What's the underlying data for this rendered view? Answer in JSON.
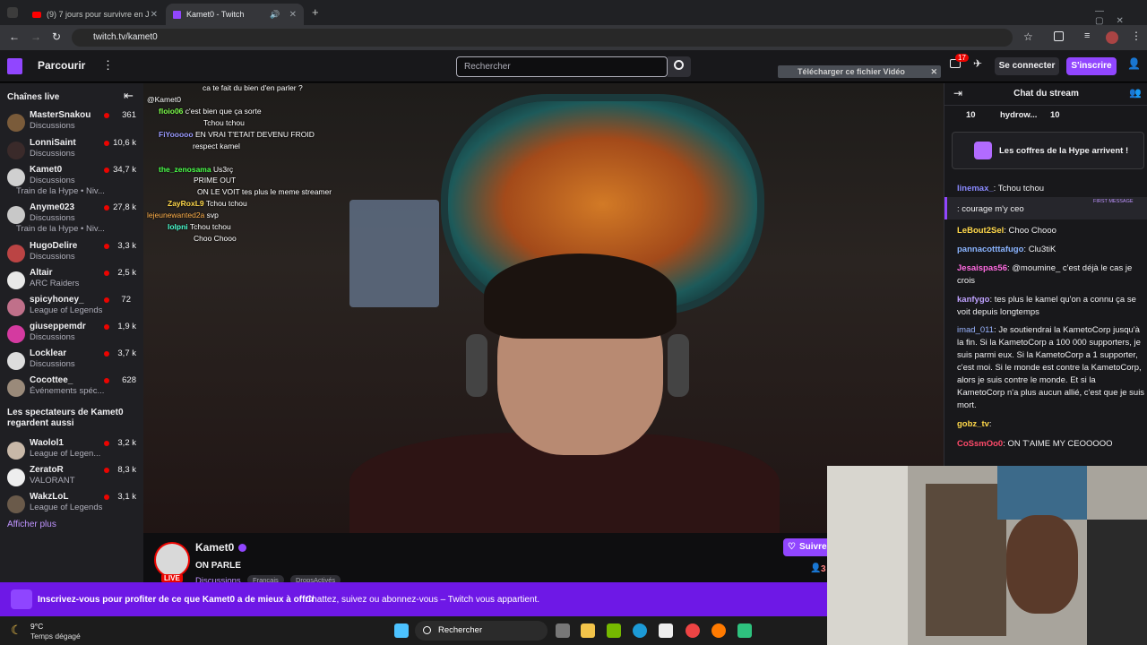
{
  "browser": {
    "tabs": [
      {
        "label": "(9) 7 jours pour survivre en Jung",
        "active": false
      },
      {
        "label": "Kamet0 - Twitch",
        "active": true
      }
    ],
    "url": "twitch.tv/kamet0"
  },
  "topnav": {
    "browse": "Parcourir",
    "search_placeholder": "Rechercher",
    "notif_count": "17",
    "login": "Se connecter",
    "signup": "S'inscrire"
  },
  "extension": {
    "download_label": "Télécharger ce fichier Vidéo"
  },
  "sidebar": {
    "live_heading": "Chaînes live",
    "channels": [
      {
        "name": "MasterSnakou",
        "category": "Discussions",
        "viewers": "361",
        "color": "#7a5b3a"
      },
      {
        "name": "LonniSaint",
        "category": "Discussions",
        "viewers": "10,6 k",
        "color": "#3a2a2a"
      },
      {
        "name": "Kamet0",
        "category": "Discussions",
        "viewers": "34,7 k",
        "extra": "Train de la Hype • Niv...",
        "color": "#d0d0d0"
      },
      {
        "name": "Anyme023",
        "category": "Discussions",
        "viewers": "27,8 k",
        "extra": "Train de la Hype • Niv...",
        "color": "#c8c8c8"
      },
      {
        "name": "HugoDelire",
        "category": "Discussions",
        "viewers": "3,3 k",
        "color": "#b44"
      },
      {
        "name": "Altair",
        "category": "ARC Raiders",
        "viewers": "2,5 k",
        "color": "#e8e8e8"
      },
      {
        "name": "spicyhoney_",
        "category": "League of Legends",
        "viewers": "72",
        "color": "#c0708a"
      },
      {
        "name": "giuseppemdr",
        "category": "Discussions",
        "viewers": "1,9 k",
        "color": "#d43aa0"
      },
      {
        "name": "Locklear",
        "category": "Discussions",
        "viewers": "3,7 k",
        "color": "#ddd"
      },
      {
        "name": "Cocottee_",
        "category": "Événements spéc...",
        "viewers": "628",
        "color": "#9a8a7a"
      }
    ],
    "also_heading_1": "Les spectateurs de Kamet0",
    "also_heading_2": "regardent aussi",
    "also": [
      {
        "name": "Waolol1",
        "category": "League of Legen...",
        "viewers": "3,2 k",
        "color": "#c8b8a8"
      },
      {
        "name": "ZeratoR",
        "category": "VALORANT",
        "viewers": "8,3 k",
        "color": "#eee"
      },
      {
        "name": "WakzLoL",
        "category": "League of Legends",
        "viewers": "3,1 k",
        "color": "#6a5a4a"
      }
    ],
    "show_more": "Afficher plus"
  },
  "overlay_chat": [
    {
      "user": "",
      "text": "ca te fait du bien d'en parler ?",
      "color": "#ff4a4a"
    },
    {
      "user": "",
      "text": "@Kamet0",
      "color": "#fff"
    },
    {
      "user": "floio06",
      "text": "c'est bien que ça sorte",
      "color": "#7cff4a"
    },
    {
      "user": "",
      "text": "Tchou tchou",
      "color": "#ff4a4a"
    },
    {
      "user": "FiYooooo",
      "text": "EN VRAI T'ETAIT DEVENU FROID",
      "color": "#9a9aff"
    },
    {
      "user": "",
      "text": "respect kamel",
      "color": "#4a4aff"
    },
    {
      "user": "",
      "text": "",
      "color": "#ff4a4a"
    },
    {
      "user": "the_zenosama",
      "text": "Us3rç",
      "color": "#4aff4a"
    },
    {
      "user": "",
      "text": "PRIME OUT",
      "color": "#ff4a4a"
    },
    {
      "user": "",
      "text": "ON LE VOIT tes plus le meme streamer",
      "color": "#4a4aff"
    },
    {
      "user": "ZayRoxL9",
      "text": "Tchou tchou",
      "color": "#ffd84a"
    },
    {
      "user": "lejeunewanted2a",
      "text": "svp",
      "color": "#ffb04a"
    },
    {
      "user": "lolpni",
      "text": "Tchou tchou",
      "color": "#4affd0"
    },
    {
      "user": "",
      "text": "Choo Chooo",
      "color": "#4aff4a"
    }
  ],
  "stream": {
    "channel": "Kamet0",
    "title": "ON PARLE",
    "category": "Discussions",
    "tags": [
      "Français",
      "DropsActivés"
    ],
    "live": "LIVE",
    "follow": "Suivre",
    "viewers_short": "3"
  },
  "chat": {
    "title": "Chat du stream",
    "hype_user_count_1": "10",
    "hype_user": "hydrow...",
    "hype_user_count_2": "10",
    "hype_chest": "Les coffres de la Hype arrivent !",
    "first_message_label": "FIRST MESSAGE",
    "messages": [
      {
        "user": "linemax_",
        "text": "Tchou tchou",
        "color": "#8a8aff"
      },
      {
        "user": "",
        "text": "courage m'y ceo",
        "color": "#d43a8a"
      },
      {
        "user": "LeBout2Sel",
        "text": "Choo Chooo",
        "color": "#ffd84a"
      },
      {
        "user": "pannacotttafugo",
        "text": "Clu3tiK",
        "color": "#8ab4ff"
      },
      {
        "user": "Jesaispas56",
        "text": "@moumine_ c'est déjà le cas je crois",
        "color": "#ff6ae0"
      },
      {
        "user": "kanfygo",
        "text": "tes plus le kamel qu'on a connu ça se voit depuis longtemps",
        "color": "#bfa2ff"
      },
      {
        "user": "imad_011",
        "text": "Je soutiendrai la KametoCorp jusqu'à la fin. Si la KametoCorp a 100 000 supporters, je suis parmi eux. Si la KametoCorp a 1 supporter, c'est moi. Si le monde est contre la KametoCorp, alors je suis contre le monde. Et si la KametoCorp n'a plus aucun allié, c'est que je suis mort.",
        "color": "#9ab4ff"
      },
      {
        "user": "gobz_tv",
        "text": "",
        "color": "#ffd84a"
      },
      {
        "user": "CoSsmOo0",
        "text": "ON T'AIME MY CEOOOOO",
        "color": "#ff4a6a"
      }
    ]
  },
  "banner": {
    "bold": "Inscrivez-vous pour profiter de ce que Kamet0 a de mieux à offrir",
    "text": "Chattez, suivez ou abonnez-vous – Twitch vous appartient."
  },
  "taskbar": {
    "temp": "9°C",
    "weather": "Temps dégagé",
    "search": "Rechercher"
  }
}
